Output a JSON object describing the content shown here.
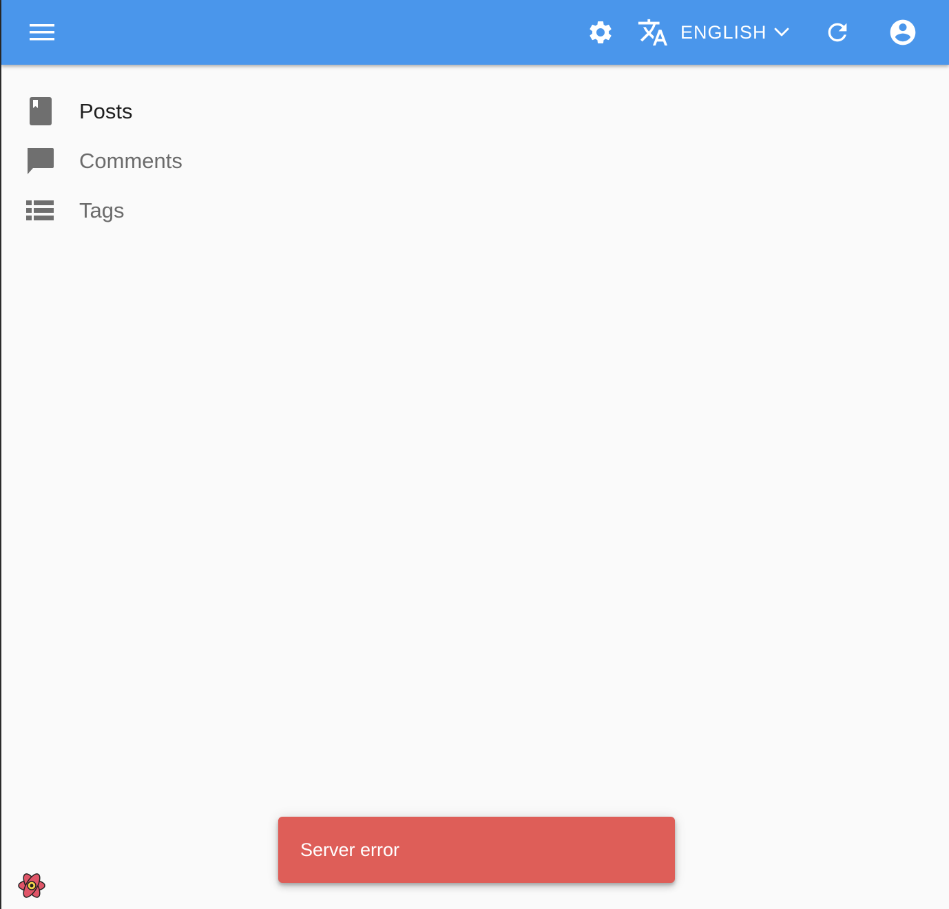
{
  "header": {
    "menu_icon": "hamburger-menu-icon",
    "settings_icon": "gear-icon",
    "language": {
      "icon": "translate-icon",
      "label": "ENGLISH",
      "chevron": "chevron-down-icon"
    },
    "refresh_icon": "refresh-icon",
    "account_icon": "account-circle-icon",
    "color": "#4a96eb"
  },
  "sidebar": {
    "items": [
      {
        "label": "Posts",
        "icon": "book-icon",
        "active": true
      },
      {
        "label": "Comments",
        "icon": "chat-bubble-icon",
        "active": false
      },
      {
        "label": "Tags",
        "icon": "list-icon",
        "active": false
      }
    ]
  },
  "notification": {
    "message": "Server error",
    "color": "#de5e58"
  },
  "devtools": {
    "icon": "react-devtools-logo-icon"
  }
}
